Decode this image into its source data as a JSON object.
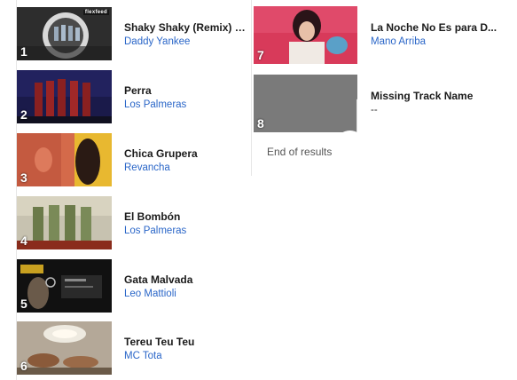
{
  "left_tracks": [
    {
      "number": "1",
      "title": "Shaky Shaky (Remix) (f...",
      "artist": "Daddy Yankee"
    },
    {
      "number": "2",
      "title": "Perra",
      "artist": "Los Palmeras"
    },
    {
      "number": "3",
      "title": "Chica Grupera",
      "artist": "Revancha"
    },
    {
      "number": "4",
      "title": "El Bombón",
      "artist": "Los Palmeras"
    },
    {
      "number": "5",
      "title": "Gata Malvada",
      "artist": "Leo Mattioli"
    },
    {
      "number": "6",
      "title": "Tereu Teu Teu",
      "artist": "MC Tota"
    }
  ],
  "right_tracks": [
    {
      "number": "7",
      "title": "La Noche No Es para D...",
      "artist": "Mano Arriba"
    },
    {
      "number": "8",
      "title": "Missing Track Name",
      "artist": "--"
    }
  ],
  "end_of_results": "End of results",
  "thumb_badges": {
    "track1": "flexfeed"
  },
  "icons": {
    "missing_art": "music-note-icon"
  },
  "colors": {
    "artist_link": "#2a66c8",
    "title": "#1a1a1a",
    "placeholder_bg": "#7a7a7a"
  }
}
